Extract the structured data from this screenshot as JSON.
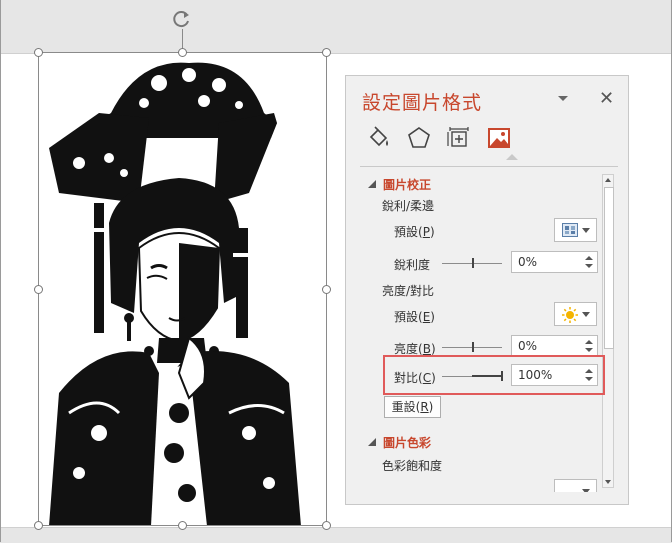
{
  "pane": {
    "title": "設定圖片格式",
    "tabs": [
      {
        "name": "fill-and-line",
        "icon": "paint-bucket-icon"
      },
      {
        "name": "effects",
        "icon": "pentagon-icon"
      },
      {
        "name": "size-and-properties",
        "icon": "size-properties-icon"
      },
      {
        "name": "picture",
        "icon": "picture-icon",
        "active": true
      }
    ],
    "correction": {
      "header": "圖片校正",
      "sharpen_soften": "銳利/柔邊",
      "preset_label_1": "預設",
      "preset_key_1": "P",
      "sharpness_label": "銳利度",
      "sharpness_value": "0%",
      "brightness_contrast": "亮度/對比",
      "preset_label_2": "預設",
      "preset_key_2": "E",
      "brightness_label": "亮度",
      "brightness_key": "B",
      "brightness_value": "0%",
      "contrast_label": "對比",
      "contrast_key": "C",
      "contrast_value": "100%",
      "reset_label": "重設",
      "reset_key": "R"
    },
    "color": {
      "header": "圖片色彩",
      "saturation": "色彩飽和度"
    }
  },
  "colors": {
    "accent": "#c8472d",
    "highlight": "#e05a5a"
  }
}
